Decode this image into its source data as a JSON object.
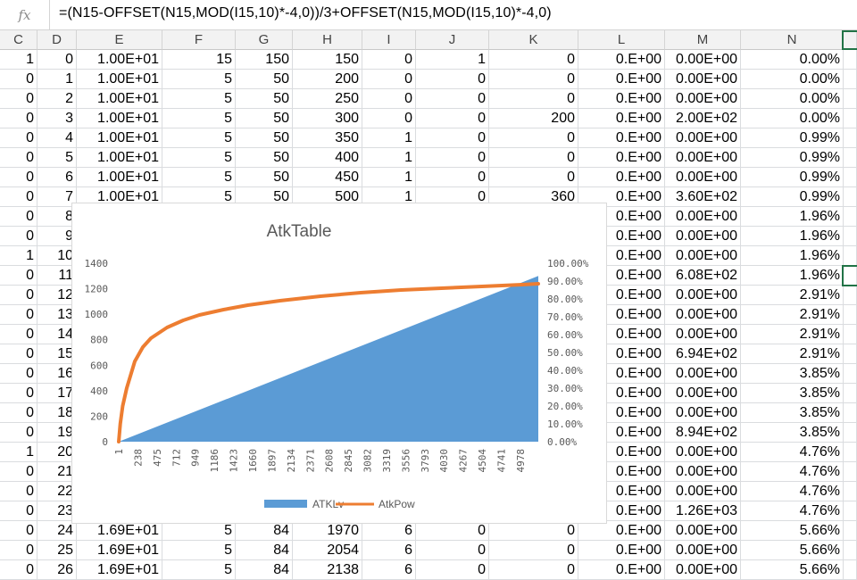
{
  "formula_bar": {
    "fx_label": "fx",
    "formula": "=(N15-OFFSET(N15,MOD(I15,10)*-4,0))/3+OFFSET(N15,MOD(I15,10)*-4,0)"
  },
  "columns": [
    "C",
    "D",
    "E",
    "F",
    "G",
    "H",
    "I",
    "J",
    "K",
    "L",
    "M",
    "N"
  ],
  "rows": [
    [
      "1",
      "0",
      "1.00E+01",
      "15",
      "150",
      "150",
      "0",
      "1",
      "0",
      "0.E+00",
      "0.00E+00",
      "0.00%"
    ],
    [
      "0",
      "1",
      "1.00E+01",
      "5",
      "50",
      "200",
      "0",
      "0",
      "0",
      "0.E+00",
      "0.00E+00",
      "0.00%"
    ],
    [
      "0",
      "2",
      "1.00E+01",
      "5",
      "50",
      "250",
      "0",
      "0",
      "0",
      "0.E+00",
      "0.00E+00",
      "0.00%"
    ],
    [
      "0",
      "3",
      "1.00E+01",
      "5",
      "50",
      "300",
      "0",
      "0",
      "200",
      "0.E+00",
      "2.00E+02",
      "0.00%"
    ],
    [
      "0",
      "4",
      "1.00E+01",
      "5",
      "50",
      "350",
      "1",
      "0",
      "0",
      "0.E+00",
      "0.00E+00",
      "0.99%"
    ],
    [
      "0",
      "5",
      "1.00E+01",
      "5",
      "50",
      "400",
      "1",
      "0",
      "0",
      "0.E+00",
      "0.00E+00",
      "0.99%"
    ],
    [
      "0",
      "6",
      "1.00E+01",
      "5",
      "50",
      "450",
      "1",
      "0",
      "0",
      "0.E+00",
      "0.00E+00",
      "0.99%"
    ],
    [
      "0",
      "7",
      "1.00E+01",
      "5",
      "50",
      "500",
      "1",
      "0",
      "360",
      "0.E+00",
      "3.60E+02",
      "0.99%"
    ],
    [
      "0",
      "8",
      "",
      "",
      "",
      "",
      "",
      "",
      "",
      "0.E+00",
      "0.00E+00",
      "1.96%"
    ],
    [
      "0",
      "9",
      "",
      "",
      "",
      "",
      "",
      "",
      "",
      "0.E+00",
      "0.00E+00",
      "1.96%"
    ],
    [
      "1",
      "10",
      "",
      "",
      "",
      "",
      "",
      "",
      "",
      "0.E+00",
      "0.00E+00",
      "1.96%"
    ],
    [
      "0",
      "11",
      "",
      "",
      "",
      "",
      "",
      "",
      "",
      "0.E+00",
      "6.08E+02",
      "1.96%"
    ],
    [
      "0",
      "12",
      "",
      "",
      "",
      "",
      "",
      "",
      "",
      "0.E+00",
      "0.00E+00",
      "2.91%"
    ],
    [
      "0",
      "13",
      "",
      "",
      "",
      "",
      "",
      "",
      "",
      "0.E+00",
      "0.00E+00",
      "2.91%"
    ],
    [
      "0",
      "14",
      "",
      "",
      "",
      "",
      "",
      "",
      "",
      "0.E+00",
      "0.00E+00",
      "2.91%"
    ],
    [
      "0",
      "15",
      "",
      "",
      "",
      "",
      "",
      "",
      "",
      "0.E+00",
      "6.94E+02",
      "2.91%"
    ],
    [
      "0",
      "16",
      "",
      "",
      "",
      "",
      "",
      "",
      "",
      "0.E+00",
      "0.00E+00",
      "3.85%"
    ],
    [
      "0",
      "17",
      "",
      "",
      "",
      "",
      "",
      "",
      "",
      "0.E+00",
      "0.00E+00",
      "3.85%"
    ],
    [
      "0",
      "18",
      "",
      "",
      "",
      "",
      "",
      "",
      "",
      "0.E+00",
      "0.00E+00",
      "3.85%"
    ],
    [
      "0",
      "19",
      "",
      "",
      "",
      "",
      "",
      "",
      "",
      "0.E+00",
      "8.94E+02",
      "3.85%"
    ],
    [
      "1",
      "20",
      "",
      "",
      "",
      "",
      "",
      "",
      "",
      "0.E+00",
      "0.00E+00",
      "4.76%"
    ],
    [
      "0",
      "21",
      "",
      "",
      "",
      "",
      "",
      "",
      "",
      "0.E+00",
      "0.00E+00",
      "4.76%"
    ],
    [
      "0",
      "22",
      "",
      "",
      "",
      "",
      "",
      "",
      "",
      "0.E+00",
      "0.00E+00",
      "4.76%"
    ],
    [
      "0",
      "23",
      "",
      "",
      "",
      "",
      "",
      "",
      "",
      "0.E+00",
      "1.26E+03",
      "4.76%"
    ],
    [
      "0",
      "24",
      "1.69E+01",
      "5",
      "84",
      "1970",
      "6",
      "0",
      "0",
      "0.E+00",
      "0.00E+00",
      "5.66%"
    ],
    [
      "0",
      "25",
      "1.69E+01",
      "5",
      "84",
      "2054",
      "6",
      "0",
      "0",
      "0.E+00",
      "0.00E+00",
      "5.66%"
    ],
    [
      "0",
      "26",
      "1.69E+01",
      "5",
      "84",
      "2138",
      "6",
      "0",
      "0",
      "0.E+00",
      "0.00E+00",
      "5.66%"
    ]
  ],
  "chart_data": {
    "type": "area+line",
    "title": "AtkTable",
    "legend_position": "bottom",
    "x_tick_labels": [
      "1",
      "238",
      "475",
      "712",
      "949",
      "1186",
      "1423",
      "1660",
      "1897",
      "2134",
      "2371",
      "2608",
      "2845",
      "3082",
      "3319",
      "3556",
      "3793",
      "4030",
      "4267",
      "4504",
      "4741",
      "4978"
    ],
    "x_range": [
      1,
      5200
    ],
    "primary_axis": {
      "ticks": [
        "0",
        "200",
        "400",
        "600",
        "800",
        "1000",
        "1200",
        "1400"
      ],
      "range": [
        0,
        1400
      ]
    },
    "secondary_axis": {
      "ticks": [
        "0.00%",
        "10.00%",
        "20.00%",
        "30.00%",
        "40.00%",
        "50.00%",
        "60.00%",
        "70.00%",
        "80.00%",
        "90.00%",
        "100.00%"
      ],
      "range": [
        0,
        1.0
      ]
    },
    "series": [
      {
        "name": "ATKLv",
        "type": "area",
        "axis": "primary",
        "color": "#5b9bd5",
        "x": [
          1,
          5200
        ],
        "y": [
          0,
          1300
        ]
      },
      {
        "name": "AtkPow",
        "type": "line",
        "axis": "secondary",
        "color": "#ed7d31",
        "x": [
          1,
          20,
          50,
          100,
          200,
          300,
          400,
          600,
          800,
          1000,
          1300,
          1600,
          2000,
          2500,
          3000,
          3500,
          4000,
          4500,
          5000,
          5200
        ],
        "y": [
          0,
          0.1,
          0.2,
          0.3,
          0.45,
          0.53,
          0.58,
          0.64,
          0.68,
          0.71,
          0.74,
          0.765,
          0.79,
          0.815,
          0.835,
          0.85,
          0.86,
          0.87,
          0.88,
          0.885
        ]
      }
    ]
  }
}
